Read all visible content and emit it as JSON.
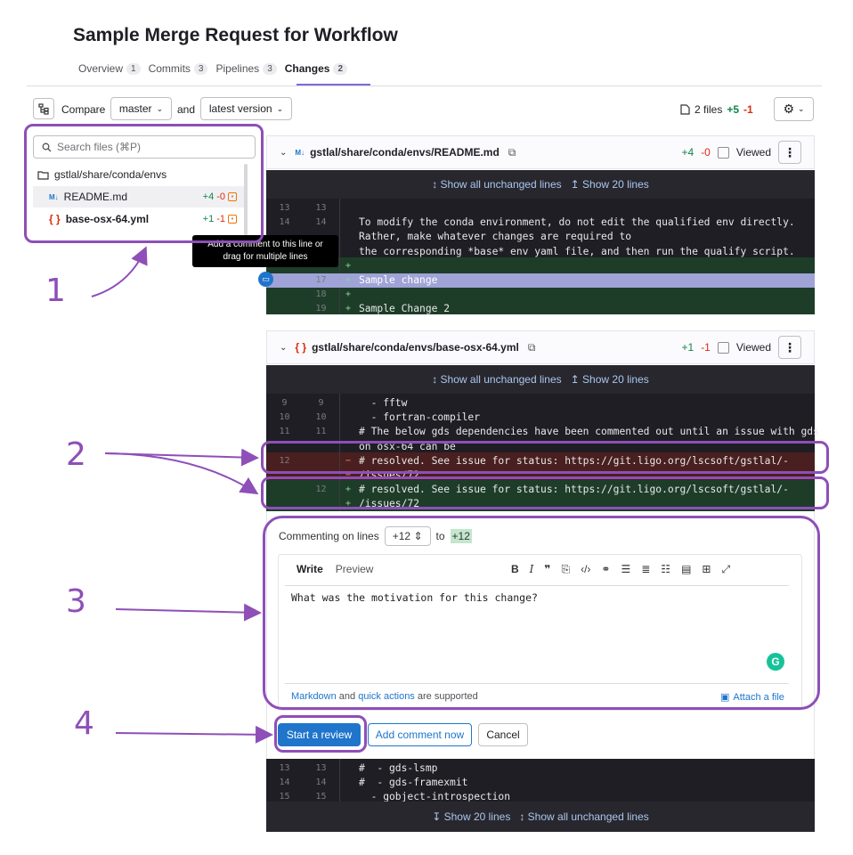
{
  "page": {
    "title": "Sample Merge Request for Workflow"
  },
  "tabs": [
    {
      "label": "Overview",
      "count": "1"
    },
    {
      "label": "Commits",
      "count": "3"
    },
    {
      "label": "Pipelines",
      "count": "3"
    },
    {
      "label": "Changes",
      "count": "2"
    }
  ],
  "toolbar": {
    "compare_label": "Compare",
    "source_branch": "master",
    "and_label": "and",
    "target_version": "latest version",
    "files_count": "2 files",
    "additions": "+5",
    "deletions": "-1"
  },
  "file_tree": {
    "search_placeholder": "Search files (⌘P)",
    "folder": "gstlal/share/conda/envs",
    "files": [
      {
        "name": "README.md",
        "icon": "M↓",
        "additions": "+4",
        "deletions": "-0"
      },
      {
        "name": "base-osx-64.yml",
        "icon": "{ }",
        "additions": "+1",
        "deletions": "-1"
      }
    ]
  },
  "tooltip": {
    "line1": "Add a comment to this line or",
    "line2": "drag for multiple lines"
  },
  "files": [
    {
      "path": "gstlal/share/conda/envs/README.md",
      "icon": "M↓",
      "additions": "+4",
      "deletions": "-0",
      "viewed_label": "Viewed",
      "expand_all": "↕ Show all unchanged lines",
      "expand_20": "↥ Show 20 lines",
      "lines": [
        {
          "old": "13",
          "new": "13",
          "code": ""
        },
        {
          "old": "14",
          "new": "14",
          "code": "To modify the conda environment, do not edit the qualified env directly."
        },
        {
          "old": "",
          "new": "",
          "code": "Rather, make whatever changes are required to"
        },
        {
          "old": "",
          "new": "",
          "code": "the corresponding *base* env yaml file, and then run the qualify script."
        },
        {
          "old": "",
          "new": "",
          "code": ""
        },
        {
          "old": "",
          "new": "17",
          "code": "Sample change"
        },
        {
          "old": "",
          "new": "18",
          "code": ""
        },
        {
          "old": "",
          "new": "19",
          "code": "Sample Change 2"
        }
      ]
    },
    {
      "path": "gstlal/share/conda/envs/base-osx-64.yml",
      "icon": "{ }",
      "additions": "+1",
      "deletions": "-1",
      "viewed_label": "Viewed",
      "expand_all": "↕ Show all unchanged lines",
      "expand_20": "↥ Show 20 lines",
      "lines": [
        {
          "old": "9",
          "new": "9",
          "code": "  - fftw"
        },
        {
          "old": "10",
          "new": "10",
          "code": "  - fortran-compiler"
        },
        {
          "old": "11",
          "new": "11",
          "code": "# The below gds dependencies have been commented out until an issue with gds"
        },
        {
          "old": "",
          "new": "",
          "code": "on osx-64 can be"
        },
        {
          "old": "12",
          "new": "",
          "code": "# resolved. See issue for status: https://git.ligo.org/lscsoft/gstlal/-"
        },
        {
          "old": "",
          "new": "",
          "code": "/issues/72"
        },
        {
          "old": "",
          "new": "12",
          "code": "# resolved. See issue for status: https://git.ligo.org/lscsoft/gstlal/-"
        },
        {
          "old": "",
          "new": "",
          "code": "/issues/72"
        }
      ],
      "trailing_lines": [
        {
          "old": "13",
          "new": "13",
          "code": "#  - gds-lsmp"
        },
        {
          "old": "14",
          "new": "14",
          "code": "#  - gds-framexmit"
        },
        {
          "old": "15",
          "new": "15",
          "code": "  - gobject-introspection"
        }
      ],
      "bottom_expand_20": "↧ Show 20 lines",
      "bottom_expand_all": "↕ Show all unchanged lines"
    }
  ],
  "comment_form": {
    "commenting_label": "Commenting on lines",
    "range_start": "+12",
    "to_label": "to",
    "range_end": "+12",
    "tab_write": "Write",
    "tab_preview": "Preview",
    "text": "What was the motivation for this change?",
    "footer_markdown": "Markdown",
    "footer_and": " and ",
    "footer_quick": "quick actions",
    "footer_rest": " are supported",
    "attach": "Attach a file"
  },
  "actions": {
    "start_review": "Start a review",
    "add_comment": "Add comment now",
    "cancel": "Cancel"
  },
  "annotations": [
    "1",
    "2",
    "3",
    "4"
  ],
  "colors": {
    "accent": "#8e4fb8",
    "primary": "#1f75cb",
    "add": "#108548",
    "del": "#dd2b0e"
  }
}
